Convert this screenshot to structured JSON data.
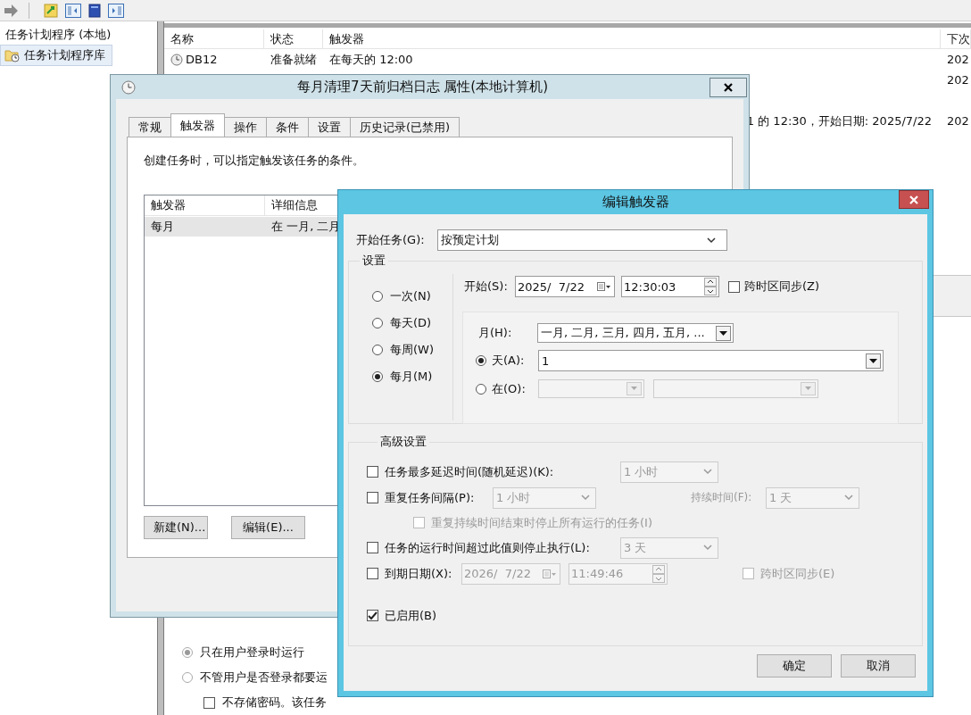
{
  "tree": [
    {
      "kind": "root",
      "label": "任务计划程序 (本地)",
      "selected": false
    },
    {
      "kind": "library",
      "label": "任务计划程序库",
      "selected": true
    }
  ],
  "task_table": {
    "columns": [
      "名称",
      "状态",
      "触发器",
      "下次"
    ],
    "rows": [
      {
        "kind": "full",
        "name": "DB12",
        "status": "准备就绪",
        "trigger": "在每天的 12:00",
        "next": "202"
      },
      {
        "kind": "covered",
        "next": "202"
      },
      {
        "kind": "covered"
      },
      {
        "kind": "covered",
        "trigger": "1 的 12:30，开始日期: 2025/7/22",
        "next": "202"
      }
    ]
  },
  "general_pane": {
    "radios": [
      {
        "label": "只在用户登录时运行",
        "selected": true
      },
      {
        "label": "不管用户是否登录都要运",
        "selected": false
      }
    ],
    "checkbox": {
      "label": "不存储密码。该任务",
      "checked": false
    }
  },
  "properties_dialog": {
    "title": "每月清理7天前归档日志 属性(本地计算机)",
    "tabs": [
      {
        "label": "常规",
        "selected": false
      },
      {
        "label": "触发器",
        "selected": true
      },
      {
        "label": "操作",
        "selected": false
      },
      {
        "label": "条件",
        "selected": false
      },
      {
        "label": "设置",
        "selected": false
      },
      {
        "label": "历史记录(已禁用)",
        "selected": false
      }
    ],
    "description": "创建任务时，可以指定触发该任务的条件。",
    "trigger_table": {
      "columns": [
        "触发器",
        "详细信息"
      ],
      "rows": [
        {
          "cells": [
            "每月",
            "在 一月, 二月"
          ],
          "selected": true
        }
      ]
    },
    "buttons": [
      "新建(N)...",
      "编辑(E)..."
    ]
  },
  "edit_dialog": {
    "title": "编辑触发器",
    "begin_label": "开始任务(G):",
    "begin_value": "按预定计划",
    "settings_label": "设置",
    "schedules": [
      {
        "label": "一次(N)",
        "selected": false
      },
      {
        "label": "每天(D)",
        "selected": false
      },
      {
        "label": "每周(W)",
        "selected": false
      },
      {
        "label": "每月(M)",
        "selected": true
      }
    ],
    "start_label": "开始(S):",
    "start_date": "2025/  7/22",
    "start_time": "12:30:03",
    "sync": {
      "label": "跨时区同步(Z)",
      "checked": false
    },
    "months_label": "月(H):",
    "months_value": "一月, 二月, 三月, 四月, 五月, ...",
    "day_modes": [
      {
        "kind": "days",
        "label": "天(A):",
        "selected": true,
        "value": "1"
      },
      {
        "kind": "on",
        "label": "在(O):",
        "selected": false
      }
    ],
    "advanced_label": "高级设置",
    "advanced": [
      {
        "kind": "delay",
        "label": "任务最多延迟时间(随机延迟)(K):",
        "checked": false,
        "value": "1 小时"
      },
      {
        "kind": "repeat",
        "label": "重复任务间隔(P):",
        "checked": false,
        "value": "1 小时",
        "duration_label": "持续时间(F):",
        "duration_value": "1 天"
      },
      {
        "kind": "sub",
        "label": "重复持续时间结束时停止所有运行的任务(I)",
        "checked": false,
        "disabled": true
      },
      {
        "kind": "stop",
        "label": "任务的运行时间超过此值则停止执行(L):",
        "checked": false,
        "value": "3 天"
      },
      {
        "kind": "expire",
        "label": "到期日期(X):",
        "checked": false,
        "date": "2026/  7/22",
        "time": "11:49:46",
        "sync_label": "跨时区同步(E)",
        "sync_checked": false
      },
      {
        "kind": "enabled",
        "label": "已启用(B)",
        "checked": true
      }
    ],
    "buttons": [
      "确定",
      "取消"
    ]
  }
}
